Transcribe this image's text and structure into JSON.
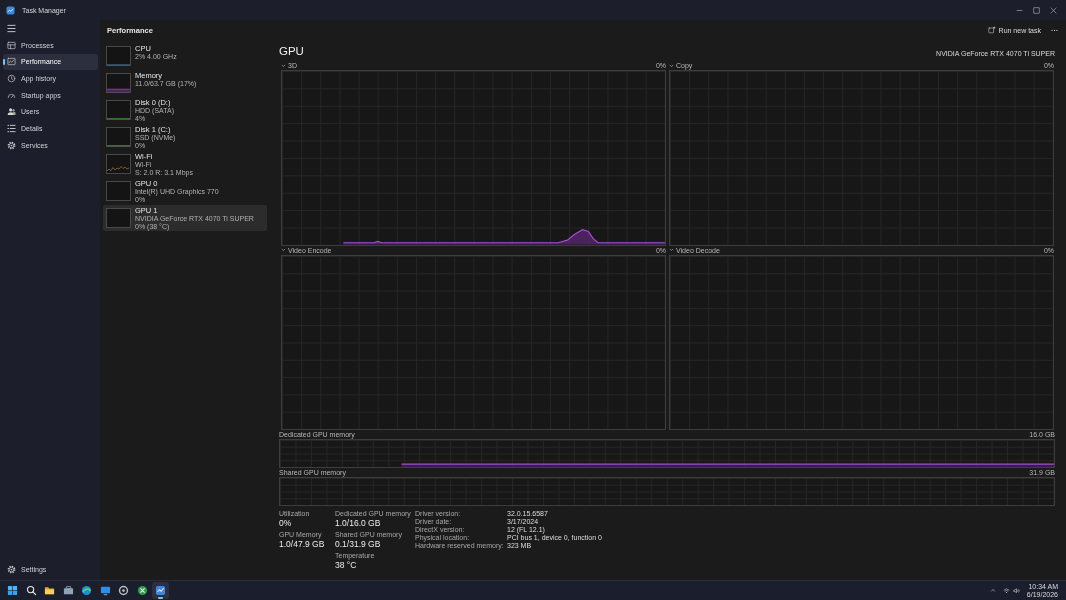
{
  "window": {
    "title": "Task Manager"
  },
  "nav": {
    "items": [
      {
        "label": "Processes",
        "selected": false
      },
      {
        "label": "Performance",
        "selected": true
      },
      {
        "label": "App history",
        "selected": false
      },
      {
        "label": "Startup apps",
        "selected": false
      },
      {
        "label": "Users",
        "selected": false
      },
      {
        "label": "Details",
        "selected": false
      },
      {
        "label": "Services",
        "selected": false
      }
    ],
    "settings": "Settings"
  },
  "page": {
    "title": "Performance",
    "action": "Run new task"
  },
  "devices": [
    {
      "kind": "cpu",
      "name": "CPU",
      "details": [
        "2% 4.00 GHz"
      ],
      "selected": false
    },
    {
      "kind": "memory",
      "name": "Memory",
      "details": [
        "11.0/63.7 GB (17%)"
      ],
      "selected": false
    },
    {
      "kind": "disk",
      "name": "Disk 0 (D:)",
      "details": [
        "HDD (SATA)",
        "4%"
      ],
      "selected": false
    },
    {
      "kind": "disk",
      "name": "Disk 1 (C:)",
      "details": [
        "SSD (NVMe)",
        "0%"
      ],
      "selected": false
    },
    {
      "kind": "network",
      "name": "Wi-Fi",
      "details": [
        "Wi-Fi",
        "S: 2.0 R: 3.1 Mbps"
      ],
      "selected": false
    },
    {
      "kind": "gpu",
      "name": "GPU 0",
      "details": [
        "Intel(R) UHD Graphics 770",
        "0%"
      ],
      "selected": false
    },
    {
      "kind": "gpu",
      "name": "GPU 1",
      "details": [
        "NVIDIA GeForce RTX 4070 Ti SUPER",
        "0% (38 °C)"
      ],
      "selected": true
    }
  ],
  "gpu": {
    "title": "GPU",
    "model": "NVIDIA GeForce RTX 4070 Ti SUPER",
    "engines": [
      {
        "name": "3D",
        "reading": "0%",
        "activity": true
      },
      {
        "name": "Copy",
        "reading": "0%",
        "activity": false
      },
      {
        "name": "Video Encode",
        "reading": "0%",
        "activity": false
      },
      {
        "name": "Video Decode",
        "reading": "0%",
        "activity": false
      }
    ],
    "memory": [
      {
        "name": "Dedicated GPU memory",
        "capacity": "16.0 GB",
        "activity": true
      },
      {
        "name": "Shared GPU memory",
        "capacity": "31.9 GB",
        "activity": false
      }
    ],
    "stats": [
      [
        {
          "label": "Utilization",
          "value": "0%"
        },
        {
          "label": "GPU Memory",
          "value": "1.0/47.9 GB"
        }
      ],
      [
        {
          "label": "Dedicated GPU memory",
          "value": "1.0/16.0 GB"
        },
        {
          "label": "Shared GPU memory",
          "value": "0.1/31.9 GB"
        },
        {
          "label": "Temperature",
          "value": "38 °C"
        }
      ]
    ],
    "details": [
      {
        "label": "Driver version:",
        "value": "32.0.15.6587"
      },
      {
        "label": "Driver date:",
        "value": "3/17/2024"
      },
      {
        "label": "DirectX version:",
        "value": "12 (FL 12.1)"
      },
      {
        "label": "Physical location:",
        "value": "PCI bus 1, device 0, function 0"
      },
      {
        "label": "Hardware reserved memory:",
        "value": "323 MB"
      }
    ]
  },
  "taskbar": {
    "apps": [
      {
        "kind": "start",
        "selected": false
      },
      {
        "kind": "search",
        "selected": false
      },
      {
        "kind": "explorer",
        "selected": false
      },
      {
        "kind": "files",
        "selected": false
      },
      {
        "kind": "browser",
        "selected": false
      },
      {
        "kind": "mail",
        "selected": false
      },
      {
        "kind": "disc",
        "selected": false
      },
      {
        "kind": "game",
        "selected": false
      },
      {
        "kind": "tasks",
        "selected": true
      }
    ],
    "time": "10:34 AM",
    "date": "6/19/2026"
  }
}
